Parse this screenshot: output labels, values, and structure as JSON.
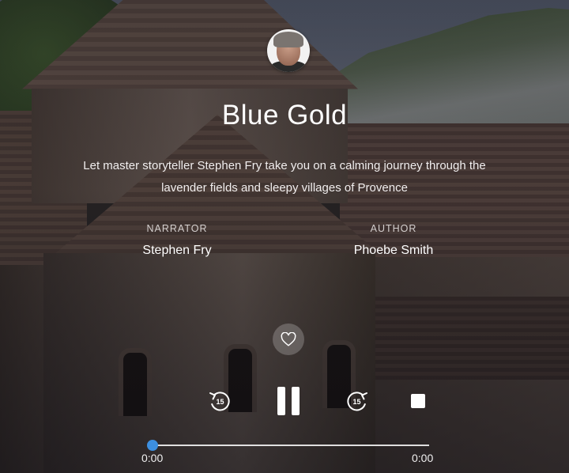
{
  "audiobook": {
    "title": "Blue Gold",
    "description": "Let master storyteller Stephen Fry take you on a calming journey through the lavender fields and sleepy villages of Provence",
    "narrator_label": "NARRATOR",
    "narrator_name": "Stephen Fry",
    "author_label": "AUTHOR",
    "author_name": "Phoebe Smith"
  },
  "controls": {
    "rewind_seconds": "15",
    "forward_seconds": "15",
    "state": "playing"
  },
  "progress": {
    "elapsed": "0:00",
    "duration": "0:00",
    "fraction": 0
  },
  "icons": {
    "favorite": "heart-icon",
    "rewind": "rewind-15-icon",
    "pause": "pause-icon",
    "forward": "forward-15-icon",
    "stop": "stop-icon"
  },
  "colors": {
    "accent": "#3d8fe0",
    "text": "#ffffff"
  }
}
